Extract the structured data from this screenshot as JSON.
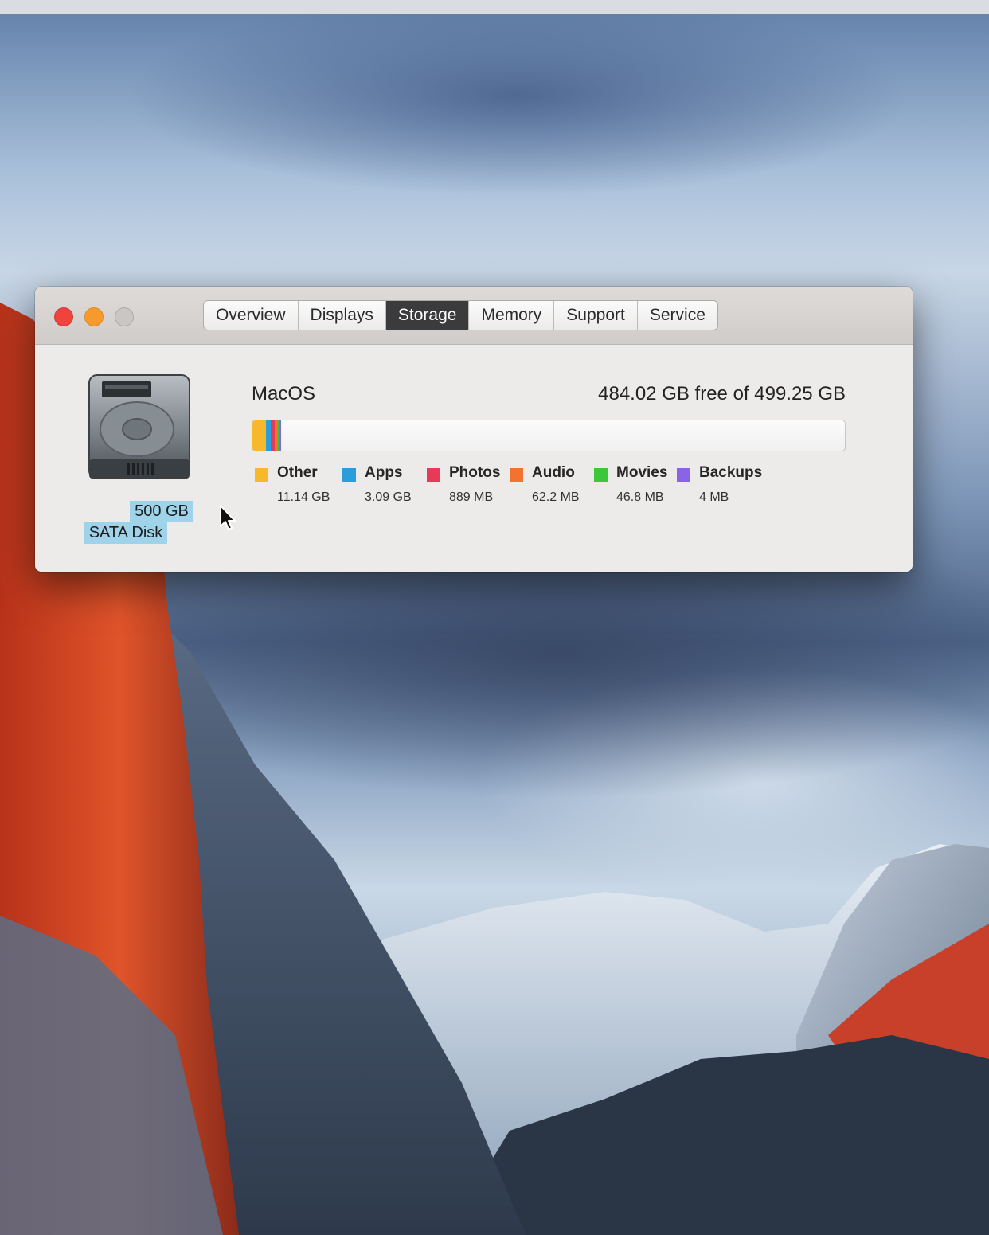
{
  "window": {
    "tabs": [
      {
        "label": "Overview",
        "active": false
      },
      {
        "label": "Displays",
        "active": false
      },
      {
        "label": "Storage",
        "active": true
      },
      {
        "label": "Memory",
        "active": false
      },
      {
        "label": "Support",
        "active": false
      },
      {
        "label": "Service",
        "active": false
      }
    ],
    "controls": {
      "close_color": "#f0433e",
      "minimize_color": "#f79a2e",
      "zoom_color": "#c9c6c4"
    }
  },
  "disk": {
    "icon": "hard-drive-icon",
    "capacity": "500 GB",
    "type": "SATA Disk"
  },
  "volume": {
    "name": "MacOS",
    "free_text": "484.02 GB free of 499.25 GB",
    "free_gb": 484.02,
    "total_gb": 499.25,
    "categories": [
      {
        "name": "Other",
        "size": "11.14 GB",
        "gb": 11.14,
        "color": "#f7b92b"
      },
      {
        "name": "Apps",
        "size": "3.09 GB",
        "gb": 3.09,
        "color": "#2c9ddb"
      },
      {
        "name": "Photos",
        "size": "889 MB",
        "gb": 0.889,
        "color": "#e63a58"
      },
      {
        "name": "Audio",
        "size": "62.2 MB",
        "gb": 0.0622,
        "color": "#f3722f"
      },
      {
        "name": "Movies",
        "size": "46.8 MB",
        "gb": 0.0468,
        "color": "#3cc63a"
      },
      {
        "name": "Backups",
        "size": "4 MB",
        "gb": 0.004,
        "color": "#8a63e6"
      }
    ]
  }
}
